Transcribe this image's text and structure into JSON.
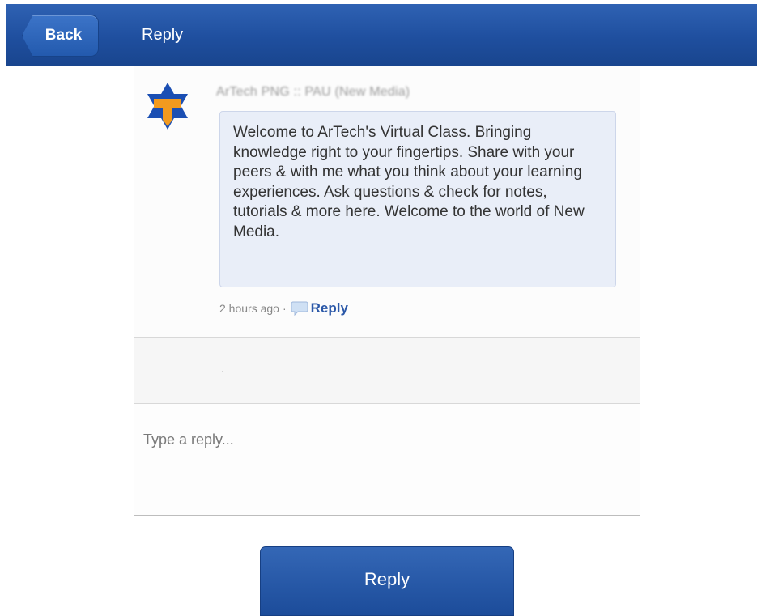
{
  "header": {
    "back_label": "Back",
    "title": "Reply"
  },
  "post": {
    "author": "ArTech PNG :: PAU (New Media)",
    "avatar_icon": "star-t-logo-icon",
    "message": "Welcome to ArTech's Virtual Class. Bringing knowledge right to your fingertips. Share with your peers & with me what you think about your learning experiences. Ask questions & check for notes, tutorials & more here. Welcome to the world of New Media.",
    "timestamp": "2 hours ago",
    "separator": "·",
    "reply_link": "Reply",
    "reply_icon": "comment-bubble-icon"
  },
  "empty_row": {
    "text": "."
  },
  "reply_form": {
    "placeholder": "Type a reply...",
    "submit_label": "Reply"
  },
  "colors": {
    "header_blue": "#1f4f9f",
    "bubble_bg": "#e9eef8",
    "link_blue": "#2b58a8",
    "logo_blue": "#1b4fb3",
    "logo_orange": "#f29a1f"
  }
}
